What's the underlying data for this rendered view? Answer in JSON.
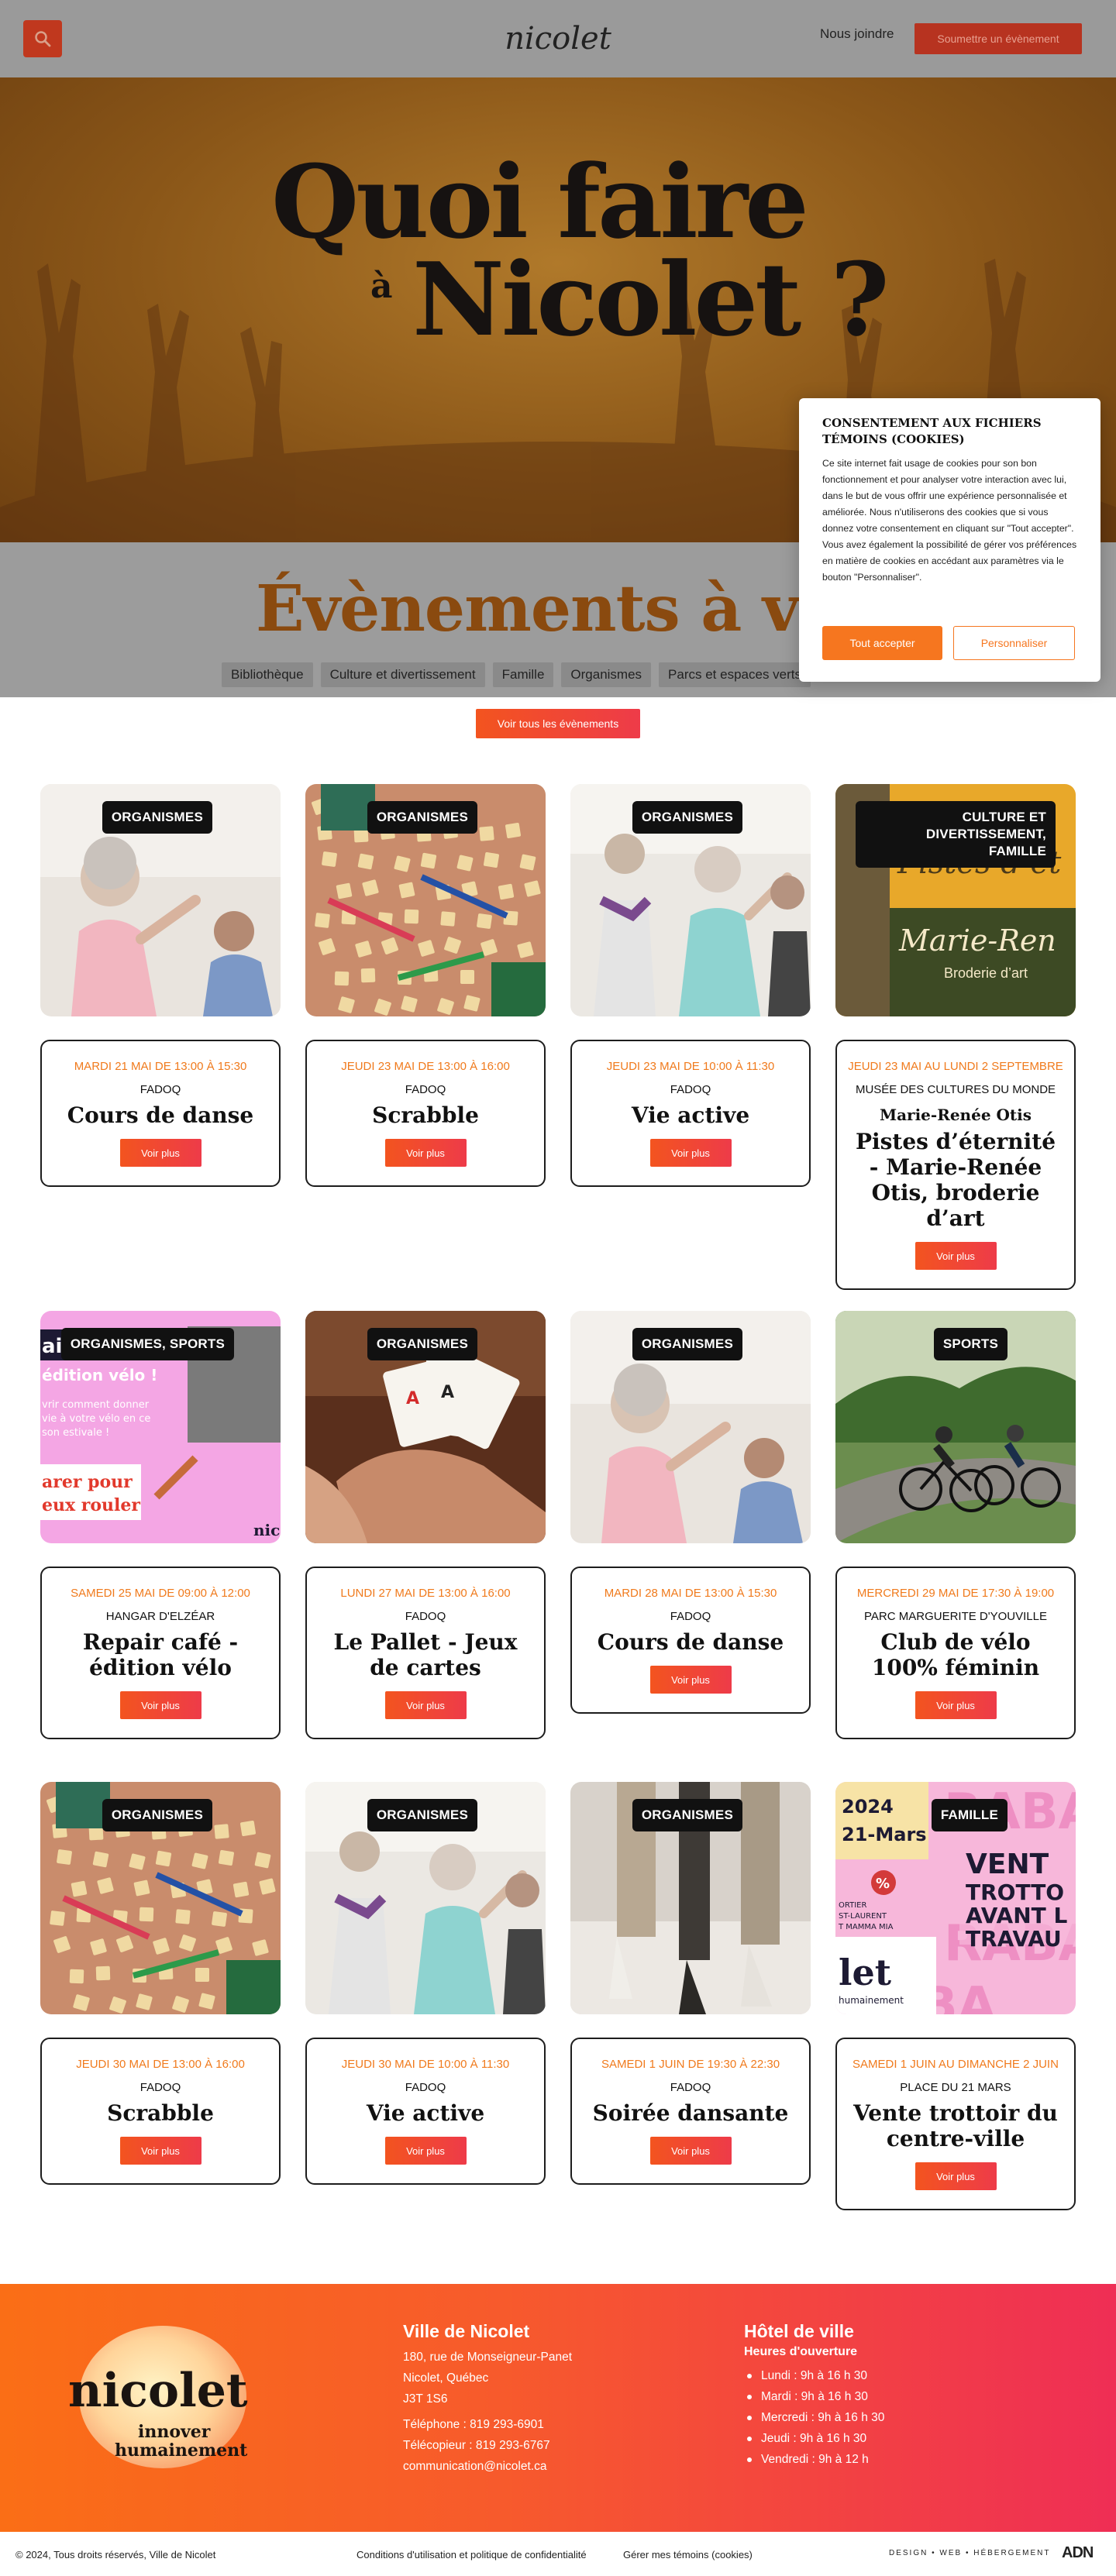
{
  "header": {
    "logo_text": "nicolet",
    "join_label": "Nous joindre",
    "submit_label": "Soumettre un évènement",
    "brand_color": "#c0381e"
  },
  "hero": {
    "line1": "Quoi faire",
    "small_a": "à",
    "line2": "Nicolet ?"
  },
  "events_section": {
    "heading": "Évènements à venir",
    "filters": [
      "Bibliothèque",
      "Culture et divertissement",
      "Famille",
      "Organismes",
      "Parcs et espaces verts"
    ],
    "see_all_label": "Voir tous les évènements"
  },
  "cookie_banner": {
    "title": "Consentement aux fichiers témoins (cookies)",
    "text": "Ce site internet fait usage de cookies pour son bon fonctionnement et pour analyser votre interaction avec lui, dans le but de vous offrir une expérience personnalisée et améliorée. Nous n'utiliserons des cookies que si vous donnez votre consentement en cliquant sur \"Tout accepter\". Vous avez également la possibilité de gérer vos préférences en matière de cookies en accédant aux paramètres via le bouton \"Personnaliser\".",
    "accept_label": "Tout accepter",
    "customize_label": "Personnaliser"
  },
  "events": [
    {
      "category": "Organismes",
      "date": "Mardi 21 mai de 13:00 à 15:30",
      "org": "FADOQ",
      "subtitle": "",
      "title": "Cours de danse",
      "button": "Voir plus",
      "image": "dance-class-photo"
    },
    {
      "category": "Organismes",
      "date": "Jeudi 23 mai de 13:00 à 16:00",
      "org": "FADOQ",
      "subtitle": "",
      "title": "Scrabble",
      "button": "Voir plus",
      "image": "scrabble-photo"
    },
    {
      "category": "Organismes",
      "date": "Jeudi 23 mai de 10:00 à 11:30",
      "org": "FADOQ",
      "subtitle": "",
      "title": "Vie active",
      "button": "Voir plus",
      "image": "active-life-photo"
    },
    {
      "category": "Culture et divertissement, Famille",
      "date": "Jeudi 23 mai au lundi 2 septembre",
      "org": "Musée des cultures du monde",
      "subtitle": "Marie-Renée Otis",
      "title": "Pistes d’éternité - Marie-Renée Otis, broderie d’art",
      "button": "Voir plus",
      "image": "exhibition-poster",
      "poster_title": "Pistes d’ét",
      "poster_name": "Marie-Ren",
      "poster_sub": "Broderie d’art"
    },
    {
      "category": "Organismes, Sports",
      "date": "Samedi 25 mai de 09:00 à 12:00",
      "org": "Hangar d'Elzéar",
      "subtitle": "",
      "title": "Repair café - édition vélo",
      "button": "Voir plus",
      "image": "repair-cafe-poster",
      "poster_line1": "air",
      "poster_line2": "édition vélo !",
      "poster_line3": "vrir comment donner",
      "poster_line4": "vie à votre vélo en ce",
      "poster_line5": "son estivale !",
      "poster_line6": "arer pour",
      "poster_line7": "eux rouler",
      "poster_brand": "nic"
    },
    {
      "category": "Organismes",
      "date": "Lundi 27 mai de 13:00 à 16:00",
      "org": "FADOQ",
      "subtitle": "",
      "title": "Le Pallet - Jeux de cartes",
      "button": "Voir plus",
      "image": "cards-photo"
    },
    {
      "category": "Organismes",
      "date": "Mardi 28 mai de 13:00 à 15:30",
      "org": "FADOQ",
      "subtitle": "",
      "title": "Cours de danse",
      "button": "Voir plus",
      "image": "dance-class-photo"
    },
    {
      "category": "Sports",
      "date": "Mercredi 29 mai de 17:30 à 19:00",
      "org": "Parc Marguerite D'Youville",
      "subtitle": "",
      "title": "Club de vélo 100% féminin",
      "button": "Voir plus",
      "image": "cycling-photo"
    },
    {
      "category": "Organismes",
      "date": "Jeudi 30 mai de 13:00 à 16:00",
      "org": "FADOQ",
      "subtitle": "",
      "title": "Scrabble",
      "button": "Voir plus",
      "image": "scrabble-photo"
    },
    {
      "category": "Organismes",
      "date": "Jeudi 30 mai de 10:00 à 11:30",
      "org": "FADOQ",
      "subtitle": "",
      "title": "Vie active",
      "button": "Voir plus",
      "image": "active-life-photo"
    },
    {
      "category": "Organismes",
      "date": "Samedi 1 juin de 19:30 à 22:30",
      "org": "FADOQ",
      "subtitle": "",
      "title": "Soirée dansante",
      "button": "Voir plus",
      "image": "dance-party-photo"
    },
    {
      "category": "Famille",
      "date": "Samedi 1 juin au dimanche 2 juin",
      "org": "Place du 21 mars",
      "subtitle": "",
      "title": "Vente trottoir du centre-ville",
      "button": "Voir plus",
      "image": "sidewalk-sale-poster",
      "poster_year": "2024",
      "poster_place": "21-Mars",
      "poster_big1": "VENT",
      "poster_big2": "TROTTO",
      "poster_big3": "AVANT L",
      "poster_big4": "TRAVAU",
      "poster_bg": "RABA",
      "poster_side1": "ORTIER",
      "poster_side2": "ST-LAURENT",
      "poster_side3": "T MAMMA MIA",
      "poster_percent": "%",
      "poster_brand": "let",
      "poster_brand_sub": "humainement"
    }
  ],
  "footer": {
    "logo_word": "nicolet",
    "logo_tag1": "innover",
    "logo_tag2": "humainement",
    "city_title": "Ville de Nicolet",
    "address1": "180, rue de Monseigneur-Panet",
    "address2": "Nicolet, Québec",
    "postal": "J3T 1S6",
    "phone": "Téléphone : 819 293-6901",
    "fax": "Télécopieur : 819 293-6767",
    "email": "communication@nicolet.ca",
    "hall_title": "Hôtel de ville",
    "hours_title": "Heures d'ouverture",
    "hours": [
      "Lundi : 9h à 16 h 30",
      "Mardi : 9h à 16 h 30",
      "Mercredi : 9h à 16 h 30",
      "Jeudi : 9h à 16 h 30",
      "Vendredi : 9h à 12 h"
    ]
  },
  "bottom_bar": {
    "copyright": "© 2024, Tous droits réservés, Ville de Nicolet",
    "legal": "Conditions d'utilisation et politique de confidentialité",
    "cookies": "Gérer mes témoins (cookies)",
    "credits": "DESIGN • WEB • HÉBERGEMENT",
    "agency": "ADN"
  }
}
